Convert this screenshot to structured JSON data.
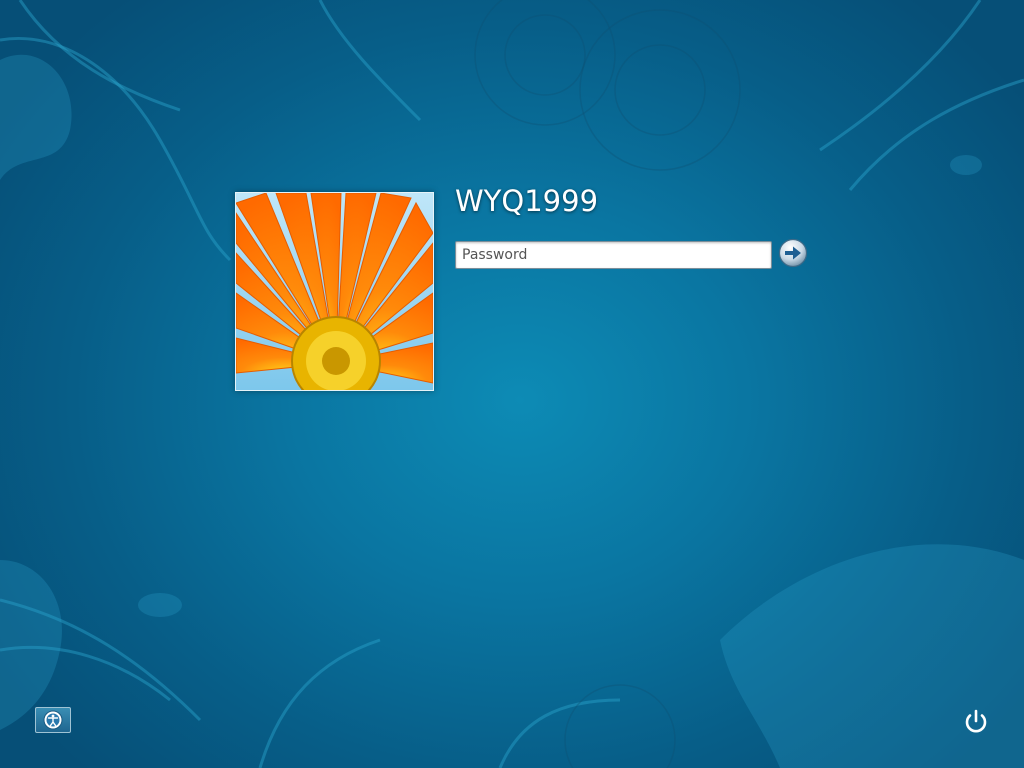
{
  "user": {
    "name": "WYQ1999",
    "avatar_icon": "orange-gerbera-daisy-picture"
  },
  "password": {
    "placeholder": "Password",
    "value": ""
  },
  "icons": {
    "submit": "arrow-right-icon",
    "ease_of_access": "ease-of-access-icon",
    "power": "power-icon"
  },
  "colors": {
    "background": "#0a75a1",
    "text": "#ffffff"
  }
}
